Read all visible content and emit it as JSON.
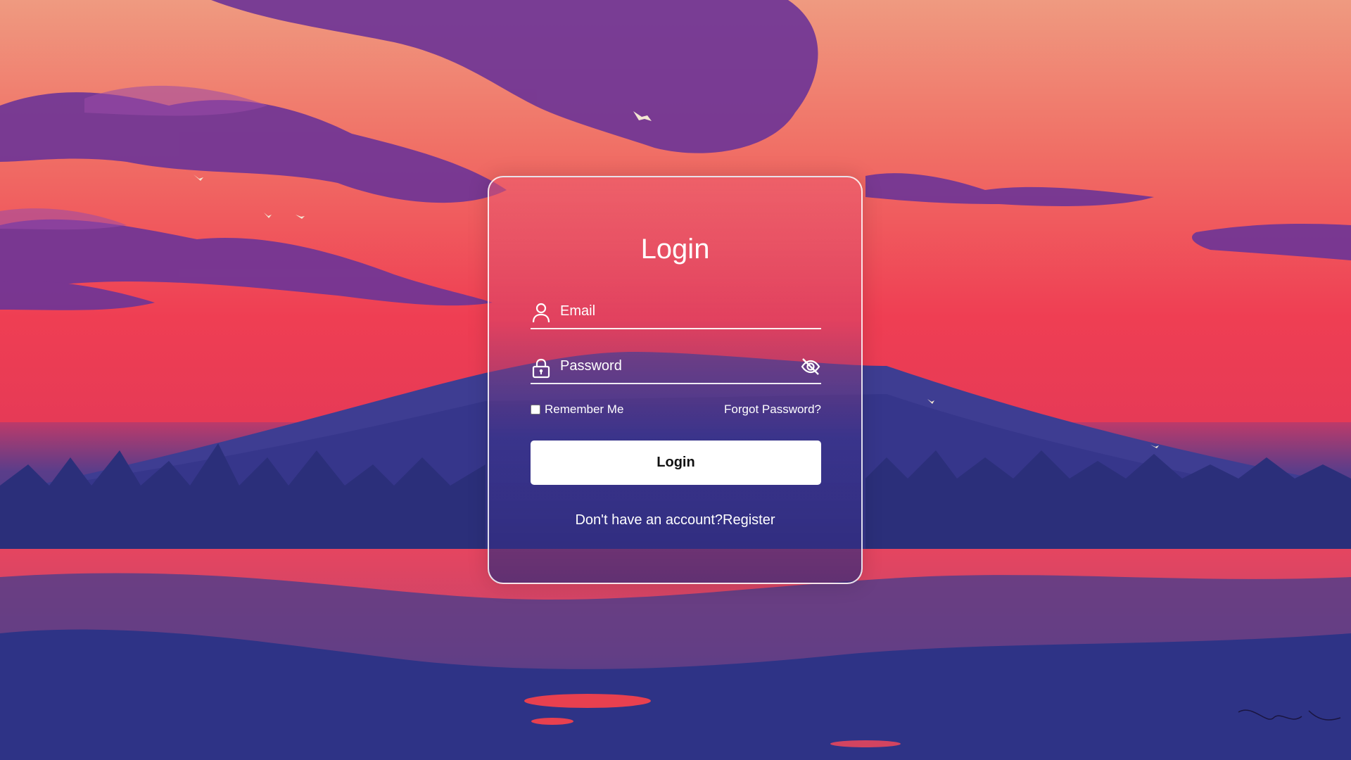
{
  "login": {
    "title": "Login",
    "email": {
      "placeholder": "Email",
      "icon": "user-icon"
    },
    "password": {
      "placeholder": "Password",
      "icon": "lock-icon",
      "toggle_icon": "eye-slash-icon"
    },
    "remember_label": "Remember Me",
    "remember_checked": false,
    "forgot_label": "Forgot Password?",
    "submit_label": "Login",
    "register_prompt": "Don't have an account?",
    "register_label": "Register"
  },
  "colors": {
    "sky_top": "#e98b78",
    "sky_red": "#ef4d5a",
    "mountain_purple": "#3b3c8f",
    "clouds": "#7a3a9a",
    "button_bg": "#ffffff",
    "text": "#ffffff"
  }
}
